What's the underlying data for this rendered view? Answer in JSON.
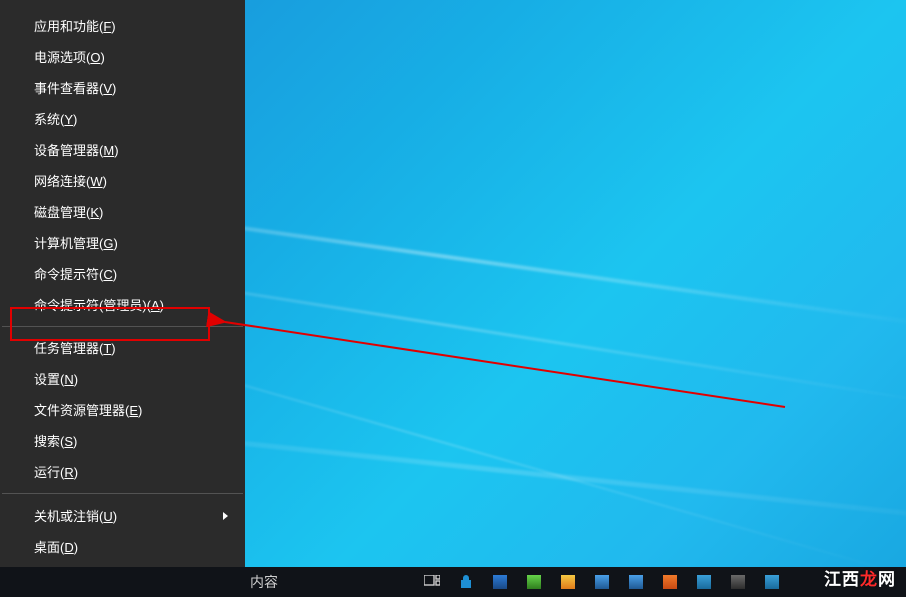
{
  "menu": {
    "items": [
      {
        "label": "应用和功能",
        "key": "F"
      },
      {
        "label": "电源选项",
        "key": "O"
      },
      {
        "label": "事件查看器",
        "key": "V"
      },
      {
        "label": "系统",
        "key": "Y"
      },
      {
        "label": "设备管理器",
        "key": "M"
      },
      {
        "label": "网络连接",
        "key": "W"
      },
      {
        "label": "磁盘管理",
        "key": "K"
      },
      {
        "label": "计算机管理",
        "key": "G"
      },
      {
        "label": "命令提示符",
        "key": "C"
      },
      {
        "label": "命令提示符(管理员)",
        "key": "A"
      },
      {
        "label": "任务管理器",
        "key": "T"
      },
      {
        "label": "设置",
        "key": "N"
      },
      {
        "label": "文件资源管理器",
        "key": "E"
      },
      {
        "label": "搜索",
        "key": "S"
      },
      {
        "label": "运行",
        "key": "R"
      },
      {
        "label": "关机或注销",
        "key": "U",
        "submenu": true
      },
      {
        "label": "桌面",
        "key": "D"
      }
    ]
  },
  "taskbar": {
    "search_snippet": "内容"
  },
  "watermark": {
    "prefix": "江西",
    "red": "龙",
    "suffix": "网"
  },
  "annotation": {
    "highlight_color": "#e10000"
  }
}
